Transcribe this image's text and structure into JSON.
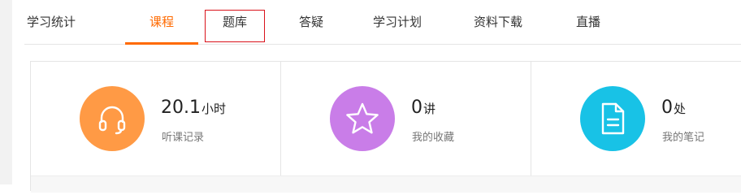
{
  "tabs": [
    {
      "label": "学习统计"
    },
    {
      "label": "课程"
    },
    {
      "label": "题库"
    },
    {
      "label": "答疑"
    },
    {
      "label": "学习计划"
    },
    {
      "label": "资料下载"
    },
    {
      "label": "直播"
    }
  ],
  "active_tab": "课程",
  "focused_tab": "题库",
  "stats": [
    {
      "value": "20.1",
      "unit": "小时",
      "label": "听课记录",
      "icon": "headphones-icon",
      "color": "#ff9a45"
    },
    {
      "value": "0",
      "unit": "讲",
      "label": "我的收藏",
      "icon": "star-icon",
      "color": "#c97de8"
    },
    {
      "value": "0",
      "unit": "处",
      "label": "我的笔记",
      "icon": "document-icon",
      "color": "#18c2e6"
    }
  ],
  "colors": {
    "accent": "#ff6a00",
    "focus_outline": "#d9121b"
  }
}
